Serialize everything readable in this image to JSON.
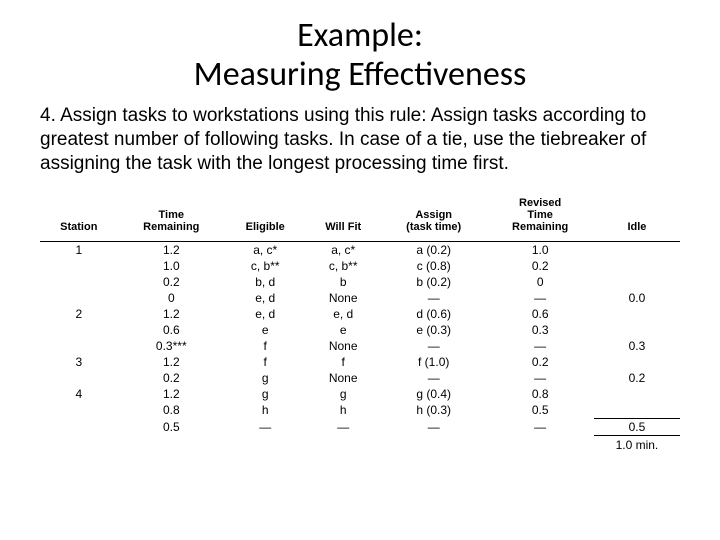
{
  "title_line1": "Example:",
  "title_line2": "Measuring Effectiveness",
  "instruction": "4. Assign tasks to workstations using this rule: Assign tasks according to greatest number of following tasks. In case of a tie, use the tiebreaker of assigning the task with the longest processing time first.",
  "headers": {
    "station": "Station",
    "time_remaining": "Time\nRemaining",
    "eligible": "Eligible",
    "will_fit": "Will Fit",
    "assign": "Assign\n(task time)",
    "revised_time": "Revised\nTime\nRemaining",
    "idle": "Idle"
  },
  "rows": [
    {
      "station": "1",
      "time": "1.2",
      "eligible": "a, c*",
      "fit": "a, c*",
      "assign": "a (0.2)",
      "revised": "1.0",
      "idle": ""
    },
    {
      "station": "",
      "time": "1.0",
      "eligible": "c, b**",
      "fit": "c, b**",
      "assign": "c (0.8)",
      "revised": "0.2",
      "idle": ""
    },
    {
      "station": "",
      "time": "0.2",
      "eligible": "b, d",
      "fit": "b",
      "assign": "b (0.2)",
      "revised": "0",
      "idle": ""
    },
    {
      "station": "",
      "time": "0",
      "eligible": "e, d",
      "fit": "None",
      "assign": "—",
      "revised": "—",
      "idle": "0.0"
    },
    {
      "station": "2",
      "time": "1.2",
      "eligible": "e, d",
      "fit": "e, d",
      "assign": "d (0.6)",
      "revised": "0.6",
      "idle": ""
    },
    {
      "station": "",
      "time": "0.6",
      "eligible": "e",
      "fit": "e",
      "assign": "e (0.3)",
      "revised": "0.3",
      "idle": ""
    },
    {
      "station": "",
      "time": "0.3***",
      "eligible": "f",
      "fit": "None",
      "assign": "—",
      "revised": "—",
      "idle": "0.3"
    },
    {
      "station": "3",
      "time": "1.2",
      "eligible": "f",
      "fit": "f",
      "assign": "f (1.0)",
      "revised": "0.2",
      "idle": ""
    },
    {
      "station": "",
      "time": "0.2",
      "eligible": "g",
      "fit": "None",
      "assign": "—",
      "revised": "—",
      "idle": "0.2"
    },
    {
      "station": "4",
      "time": "1.2",
      "eligible": "g",
      "fit": "g",
      "assign": "g (0.4)",
      "revised": "0.8",
      "idle": ""
    },
    {
      "station": "",
      "time": "0.8",
      "eligible": "h",
      "fit": "h",
      "assign": "h (0.3)",
      "revised": "0.5",
      "idle": ""
    },
    {
      "station": "",
      "time": "0.5",
      "eligible": "—",
      "fit": "—",
      "assign": "—",
      "revised": "—",
      "idle": "0.5"
    }
  ],
  "total_idle": "1.0 min.",
  "chart_data": {
    "type": "table",
    "title": "Task assignment to workstations",
    "columns": [
      "Station",
      "Time Remaining",
      "Eligible",
      "Will Fit",
      "Assign (task time)",
      "Revised Time Remaining",
      "Idle"
    ],
    "rows": [
      [
        "1",
        1.2,
        "a, c*",
        "a, c*",
        "a (0.2)",
        1.0,
        null
      ],
      [
        "",
        1.0,
        "c, b**",
        "c, b**",
        "c (0.8)",
        0.2,
        null
      ],
      [
        "",
        0.2,
        "b, d",
        "b",
        "b (0.2)",
        0,
        null
      ],
      [
        "",
        0,
        "e, d",
        "None",
        "—",
        "—",
        0.0
      ],
      [
        "2",
        1.2,
        "e, d",
        "e, d",
        "d (0.6)",
        0.6,
        null
      ],
      [
        "",
        0.6,
        "e",
        "e",
        "e (0.3)",
        0.3,
        null
      ],
      [
        "",
        0.3,
        "f",
        "None",
        "—",
        "—",
        0.3
      ],
      [
        "3",
        1.2,
        "f",
        "f",
        "f (1.0)",
        0.2,
        null
      ],
      [
        "",
        0.2,
        "g",
        "None",
        "—",
        "—",
        0.2
      ],
      [
        "4",
        1.2,
        "g",
        "g",
        "g (0.4)",
        0.8,
        null
      ],
      [
        "",
        0.8,
        "h",
        "h",
        "h (0.3)",
        0.5,
        null
      ],
      [
        "",
        0.5,
        "—",
        "—",
        "—",
        "—",
        0.5
      ]
    ],
    "total_idle_minutes": 1.0
  }
}
